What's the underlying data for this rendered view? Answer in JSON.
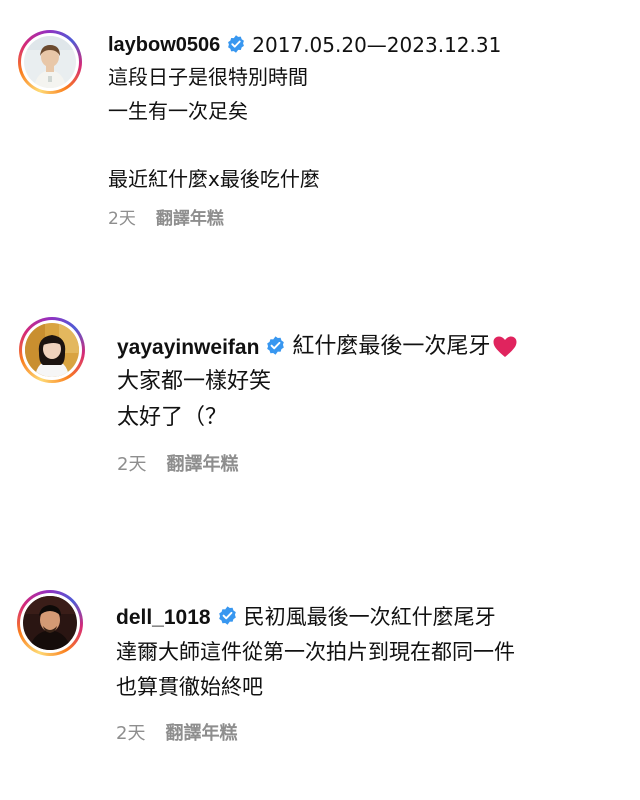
{
  "comments": [
    {
      "username": "laybow0506",
      "first_text": "2017.05.20—2023.12.31",
      "lines": [
        "這段日子是很特別時間",
        "一生有一次足矣",
        "",
        "最近紅什麼x最後吃什麼"
      ],
      "time": "2天",
      "translate_label": "翻譯年糕",
      "avatar_colors": {
        "bg": "#e9eef0",
        "skin": "#e8c7a8",
        "hair": "#6b4a2f",
        "shirt": "#f4f4f0"
      }
    },
    {
      "username": "yayayinweifan",
      "first_text": "紅什麼最後一次尾牙",
      "emoji": "❤️",
      "lines": [
        "大家都一樣好笑",
        "太好了（？"
      ],
      "time": "2天",
      "translate_label": "翻譯年糕",
      "avatar_colors": {
        "bg": "#d9a441",
        "skin": "#f0d3bd",
        "hair": "#1c1410",
        "shirt": "#f6f6f6"
      }
    },
    {
      "username": "dell_1018",
      "first_text": "民初風最後一次紅什麼尾牙",
      "lines": [
        "達爾大師這件從第一次拍片到現在都同一件",
        "也算貫徹始終吧"
      ],
      "time": "2天",
      "translate_label": "翻譯年糕",
      "avatar_colors": {
        "bg": "#2a1512",
        "skin": "#d49a74",
        "hair": "#0e0a08",
        "shirt": "#150c0a"
      }
    }
  ],
  "colors": {
    "verified_blue": "#3897f0",
    "text": "#111111",
    "meta": "#8e8e8e",
    "heart": "#e0245e"
  },
  "icons": {
    "verified": "verified-badge-icon",
    "heart": "red-heart-emoji"
  }
}
